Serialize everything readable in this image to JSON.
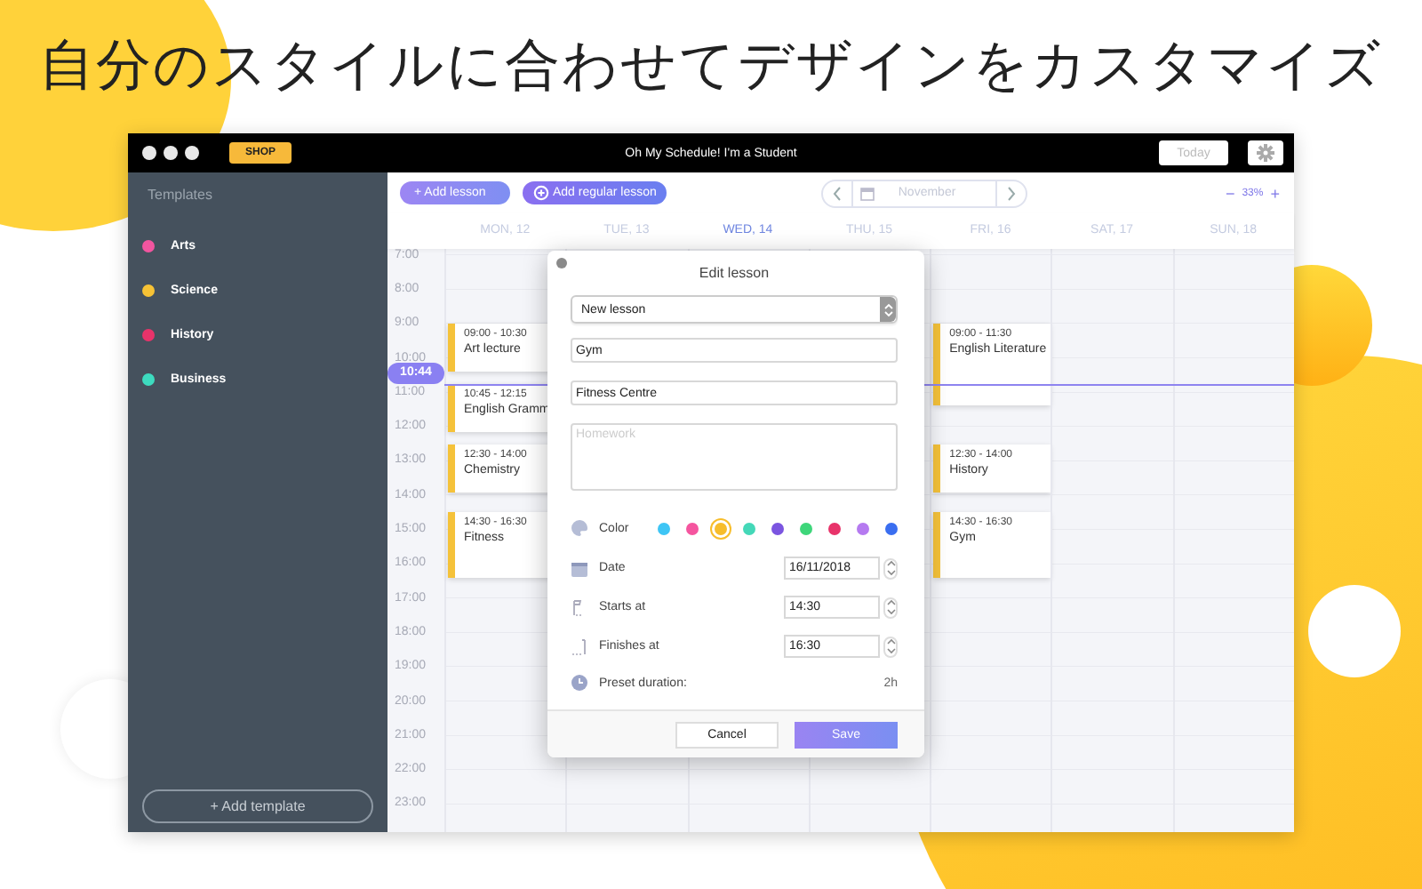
{
  "headline": "自分のスタイルに合わせてデザインをカスタマイズ",
  "window": {
    "title": "Oh My Schedule! I'm a Student",
    "shop_badge": "SHOP",
    "today_button": "Today"
  },
  "sidebar": {
    "heading": "Templates",
    "items": [
      {
        "label": "Arts",
        "color": "#f2559f"
      },
      {
        "label": "Science",
        "color": "#f6c235"
      },
      {
        "label": "History",
        "color": "#e8336a"
      },
      {
        "label": "Business",
        "color": "#3ddbbf"
      }
    ],
    "add_button": "+ Add template"
  },
  "toolbar": {
    "add_lesson": "+ Add lesson",
    "add_regular_lesson": "Add regular lesson",
    "month": "November",
    "zoom_out": "−",
    "zoom_value": "33%",
    "zoom_in": "+"
  },
  "calendar": {
    "hours": [
      "7:00",
      "8:00",
      "9:00",
      "10:00",
      "11:00",
      "12:00",
      "13:00",
      "14:00",
      "15:00",
      "16:00",
      "17:00",
      "18:00",
      "19:00",
      "20:00",
      "21:00",
      "22:00",
      "23:00"
    ],
    "current_time": "10:44",
    "days": [
      {
        "label": "MON, 12",
        "selected": false,
        "events": [
          {
            "time": "09:00 - 10:30",
            "title": "Art lecture"
          },
          {
            "time": "10:45 - 12:15",
            "title": "English Gramm"
          },
          {
            "time": "12:30 - 14:00",
            "title": "Chemistry"
          },
          {
            "time": "14:30 - 16:30",
            "title": "Fitness"
          }
        ]
      },
      {
        "label": "TUE, 13",
        "selected": false
      },
      {
        "label": "WED, 14",
        "selected": true
      },
      {
        "label": "THU, 15",
        "selected": false
      },
      {
        "label": "FRI, 16",
        "selected": false,
        "events": [
          {
            "time": "09:00 - 11:30",
            "title": "English Literature"
          },
          {
            "time": "12:30 - 14:00",
            "title": "History"
          },
          {
            "time": "14:30 - 16:30",
            "title": "Gym"
          }
        ]
      },
      {
        "label": "SAT, 17",
        "selected": false
      },
      {
        "label": "SUN, 18",
        "selected": false
      }
    ]
  },
  "dialog": {
    "title": "Edit lesson",
    "type_select": "New lesson",
    "name": "Gym",
    "location": "Fitness Centre",
    "homework_placeholder": "Homework",
    "color_label": "Color",
    "swatches": [
      {
        "color": "#3ec5f5",
        "selected": false
      },
      {
        "color": "#f5559f",
        "selected": false
      },
      {
        "color": "#f7bd2b",
        "selected": true
      },
      {
        "color": "#44d8b8",
        "selected": false
      },
      {
        "color": "#7b55e0",
        "selected": false
      },
      {
        "color": "#3ed67a",
        "selected": false
      },
      {
        "color": "#e8336a",
        "selected": false
      },
      {
        "color": "#b57af0",
        "selected": false
      },
      {
        "color": "#3a6ef0",
        "selected": false
      }
    ],
    "date_label": "Date",
    "date_value": "16/11/2018",
    "start_label": "Starts at",
    "start_value": "14:30",
    "finish_label": "Finishes at",
    "finish_value": "16:30",
    "preset_label": "Preset duration:",
    "preset_value": "2h",
    "cancel": "Cancel",
    "save": "Save"
  }
}
